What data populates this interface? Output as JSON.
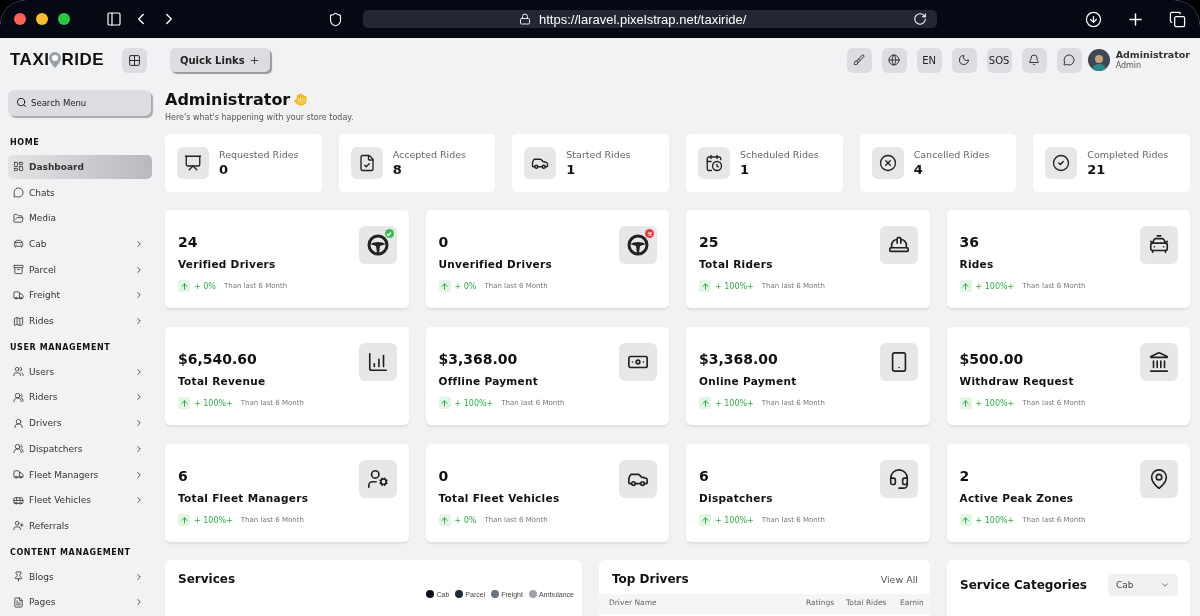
{
  "browser": {
    "url": "https://laravel.pixelstrap.net/taxiride/"
  },
  "header": {
    "logo": {
      "left": "TAXI",
      "right": "RIDE"
    },
    "quick_links": "Quick Links",
    "language": "EN",
    "sos": "SOS",
    "user": {
      "name": "Administrator",
      "role": "Admin"
    }
  },
  "sidebar": {
    "search": {
      "placeholder": "Search Menu"
    },
    "sections": [
      {
        "title": "HOME",
        "items": [
          {
            "label": "Dashboard",
            "selected": true,
            "expandable": false
          },
          {
            "label": "Chats",
            "selected": false,
            "expandable": false
          },
          {
            "label": "Media",
            "selected": false,
            "expandable": false
          },
          {
            "label": "Cab",
            "selected": false,
            "expandable": true
          },
          {
            "label": "Parcel",
            "selected": false,
            "expandable": true
          },
          {
            "label": "Freight",
            "selected": false,
            "expandable": true
          },
          {
            "label": "Rides",
            "selected": false,
            "expandable": true
          }
        ]
      },
      {
        "title": "USER MANAGEMENT",
        "items": [
          {
            "label": "Users",
            "selected": false,
            "expandable": true
          },
          {
            "label": "Riders",
            "selected": false,
            "expandable": true
          },
          {
            "label": "Drivers",
            "selected": false,
            "expandable": true
          },
          {
            "label": "Dispatchers",
            "selected": false,
            "expandable": true
          },
          {
            "label": "Fleet Managers",
            "selected": false,
            "expandable": true
          },
          {
            "label": "Fleet Vehicles",
            "selected": false,
            "expandable": true
          },
          {
            "label": "Referrals",
            "selected": false,
            "expandable": false
          }
        ]
      },
      {
        "title": "CONTENT MANAGEMENT",
        "items": [
          {
            "label": "Blogs",
            "selected": false,
            "expandable": true
          },
          {
            "label": "Pages",
            "selected": false,
            "expandable": true
          }
        ]
      }
    ]
  },
  "page": {
    "title": "Administrator",
    "subtitle": "Here's what's happening with your store today."
  },
  "ride_summary": [
    {
      "label": "Requested Rides",
      "value": "0"
    },
    {
      "label": "Accepted Rides",
      "value": "8"
    },
    {
      "label": "Started Rides",
      "value": "1"
    },
    {
      "label": "Scheduled Rides",
      "value": "1"
    },
    {
      "label": "Cancelled Rides",
      "value": "4"
    },
    {
      "label": "Completed Rides",
      "value": "21"
    }
  ],
  "stats": [
    {
      "value": "24",
      "label": "Verified Drivers",
      "change": "+ 0%",
      "note": "Than last 6 Month",
      "verified": true
    },
    {
      "value": "0",
      "label": "Unverified Drivers",
      "change": "+ 0%",
      "note": "Than last 6 Month",
      "verified": false
    },
    {
      "value": "25",
      "label": "Total Riders",
      "change": "+ 100%+",
      "note": "Than last 6 Month"
    },
    {
      "value": "36",
      "label": "Rides",
      "change": "+ 100%+",
      "note": "Than last 6 Month"
    },
    {
      "value": "$6,540.60",
      "label": "Total Revenue",
      "change": "+ 100%+",
      "note": "Than last 6 Month"
    },
    {
      "value": "$3,368.00",
      "label": "Offline Payment",
      "change": "+ 100%+",
      "note": "Than last 6 Month"
    },
    {
      "value": "$3,368.00",
      "label": "Online Payment",
      "change": "+ 100%+",
      "note": "Than last 6 Month"
    },
    {
      "value": "$500.00",
      "label": "Withdraw Request",
      "change": "+ 100%+",
      "note": "Than last 6 Month"
    },
    {
      "value": "6",
      "label": "Total Fleet Managers",
      "change": "+ 100%+",
      "note": "Than last 6 Month"
    },
    {
      "value": "0",
      "label": "Total Fleet Vehicles",
      "change": "+ 0%",
      "note": "Than last 6 Month"
    },
    {
      "value": "6",
      "label": "Dispatchers",
      "change": "+ 100%+",
      "note": "Than last 6 Month"
    },
    {
      "value": "2",
      "label": "Active Peak Zones",
      "change": "+ 100%+",
      "note": "Than last 6 Month"
    }
  ],
  "services": {
    "title": "Services",
    "legend": [
      {
        "label": "Cab",
        "color": "#0b0f1a"
      },
      {
        "label": "Parcel",
        "color": "#1f2937"
      },
      {
        "label": "Freight",
        "color": "#6b7280"
      },
      {
        "label": "Ambulance",
        "color": "#a1a1aa"
      }
    ]
  },
  "top_drivers": {
    "title": "Top Drivers",
    "link": "View All",
    "columns": [
      "Driver Name",
      "Ratings",
      "Total Rides",
      "Earnin"
    ]
  },
  "service_categories": {
    "title": "Service Categories",
    "select": "Cab"
  }
}
